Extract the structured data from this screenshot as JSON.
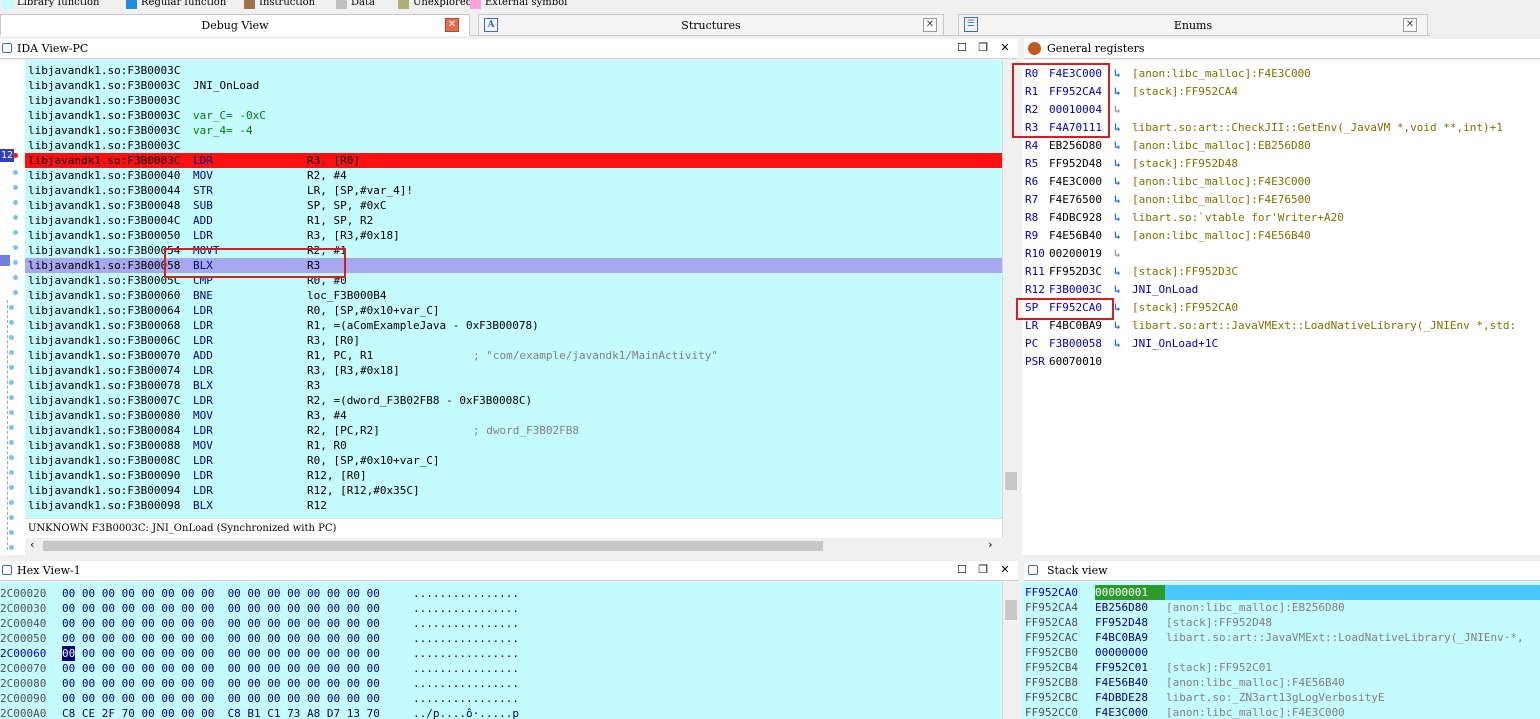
{
  "legend": [
    {
      "label": "Library function",
      "color": "#c4fcff"
    },
    {
      "label": "Regular function",
      "color": "#1e8fd8"
    },
    {
      "label": "Instruction",
      "color": "#a0724c"
    },
    {
      "label": "Data",
      "color": "#c0c0c0"
    },
    {
      "label": "Unexplored",
      "color": "#b0b070"
    },
    {
      "label": "External symbol",
      "color": "#f8a0e0"
    }
  ],
  "tabs": {
    "debug": "Debug View",
    "structures": "Structures",
    "enums": "Enums"
  },
  "ida": {
    "title": "IDA View-PC",
    "status": "UNKNOWN F3B0003C: JNI_OnLoad (Synchronized with PC)",
    "pc_badge": "12",
    "lines": [
      {
        "a": "libjavandk1.so:F3B0003C",
        "m": "",
        "o": "",
        "c": ""
      },
      {
        "a": "libjavandk1.so:F3B0003C",
        "m": "JNI_OnLoad",
        "o": "",
        "c": ""
      },
      {
        "a": "libjavandk1.so:F3B0003C",
        "m": "",
        "o": "",
        "c": ""
      },
      {
        "a": "libjavandk1.so:F3B0003C",
        "m": "var_C= -0xC",
        "o": "",
        "c": ""
      },
      {
        "a": "libjavandk1.so:F3B0003C",
        "m": "var_4= -4",
        "o": "",
        "c": ""
      },
      {
        "a": "libjavandk1.so:F3B0003C",
        "m": "",
        "o": "",
        "c": ""
      },
      {
        "a": "libjavandk1.so:F3B0003C",
        "m": "LDR",
        "o": "R3, [R0]",
        "c": ""
      },
      {
        "a": "libjavandk1.so:F3B00040",
        "m": "MOV",
        "o": "R2, #4",
        "c": ""
      },
      {
        "a": "libjavandk1.so:F3B00044",
        "m": "STR",
        "o": "LR, [SP,#var_4]!",
        "c": ""
      },
      {
        "a": "libjavandk1.so:F3B00048",
        "m": "SUB",
        "o": "SP, SP, #0xC",
        "c": ""
      },
      {
        "a": "libjavandk1.so:F3B0004C",
        "m": "ADD",
        "o": "R1, SP, R2",
        "c": ""
      },
      {
        "a": "libjavandk1.so:F3B00050",
        "m": "LDR",
        "o": "R3, [R3,#0x18]",
        "c": ""
      },
      {
        "a": "libjavandk1.so:F3B00054",
        "m": "MOVT",
        "o": "R2, #1",
        "c": ""
      },
      {
        "a": "libjavandk1.so:F3B00058",
        "m": "BLX",
        "o": "R3",
        "c": ""
      },
      {
        "a": "libjavandk1.so:F3B0005C",
        "m": "CMP",
        "o": "R0, #0",
        "c": ""
      },
      {
        "a": "libjavandk1.so:F3B00060",
        "m": "BNE",
        "o": "loc_F3B000B4",
        "c": ""
      },
      {
        "a": "libjavandk1.so:F3B00064",
        "m": "LDR",
        "o": "R0, [SP,#0x10+var_C]",
        "c": ""
      },
      {
        "a": "libjavandk1.so:F3B00068",
        "m": "LDR",
        "o": "R1, =(aComExampleJava - 0xF3B00078)",
        "c": ""
      },
      {
        "a": "libjavandk1.so:F3B0006C",
        "m": "LDR",
        "o": "R3, [R0]",
        "c": ""
      },
      {
        "a": "libjavandk1.so:F3B00070",
        "m": "ADD",
        "o": "R1, PC, R1",
        "c": "; \"com/example/javandk1/MainActivity\""
      },
      {
        "a": "libjavandk1.so:F3B00074",
        "m": "LDR",
        "o": "R3, [R3,#0x18]",
        "c": ""
      },
      {
        "a": "libjavandk1.so:F3B00078",
        "m": "BLX",
        "o": "R3",
        "c": ""
      },
      {
        "a": "libjavandk1.so:F3B0007C",
        "m": "LDR",
        "o": "R2, =(dword_F3B02FB8 - 0xF3B0008C)",
        "c": ""
      },
      {
        "a": "libjavandk1.so:F3B00080",
        "m": "MOV",
        "o": "R3, #4",
        "c": ""
      },
      {
        "a": "libjavandk1.so:F3B00084",
        "m": "LDR",
        "o": "R2, [PC,R2]",
        "c": "; dword_F3B02FB8"
      },
      {
        "a": "libjavandk1.so:F3B00088",
        "m": "MOV",
        "o": "R1, R0",
        "c": ""
      },
      {
        "a": "libjavandk1.so:F3B0008C",
        "m": "LDR",
        "o": "R0, [SP,#0x10+var_C]",
        "c": ""
      },
      {
        "a": "libjavandk1.so:F3B00090",
        "m": "LDR",
        "o": "R12, [R0]",
        "c": ""
      },
      {
        "a": "libjavandk1.so:F3B00094",
        "m": "LDR",
        "o": "R12, [R12,#0x35C]",
        "c": ""
      },
      {
        "a": "libjavandk1.so:F3B00098",
        "m": "BLX",
        "o": "R12",
        "c": ""
      }
    ]
  },
  "registers": {
    "title": "General registers",
    "rows": [
      {
        "n": "R0",
        "v": "F4E3C000",
        "d": "[anon:libc_malloc]:F4E3C000",
        "k": "olv"
      },
      {
        "n": "R1",
        "v": "FF952CA4",
        "d": "[stack]:FF952CA4",
        "k": "olv"
      },
      {
        "n": "R2",
        "v": "00010004",
        "d": "",
        "k": ""
      },
      {
        "n": "R3",
        "v": "F4A70111",
        "d": "libart.so:art::CheckJII::GetEnv(_JavaVM *,void **,int)+1",
        "k": "olv"
      },
      {
        "n": "R4",
        "v": "EB256D80",
        "d": "[anon:libc_malloc]:EB256D80",
        "k": "olv"
      },
      {
        "n": "R5",
        "v": "FF952D48",
        "d": "[stack]:FF952D48",
        "k": "olv"
      },
      {
        "n": "R6",
        "v": "F4E3C000",
        "d": "[anon:libc_malloc]:F4E3C000",
        "k": "olv"
      },
      {
        "n": "R7",
        "v": "F4E76500",
        "d": "[anon:libc_malloc]:F4E76500",
        "k": "olv"
      },
      {
        "n": "R8",
        "v": "F4DBC928",
        "d": "libart.so:`vtable for'Writer+A20",
        "k": "olv"
      },
      {
        "n": "R9",
        "v": "F4E56B40",
        "d": "[anon:libc_malloc]:F4E56B40",
        "k": "olv"
      },
      {
        "n": "R10",
        "v": "00200019",
        "d": "",
        "k": ""
      },
      {
        "n": "R11",
        "v": "FF952D3C",
        "d": "[stack]:FF952D3C",
        "k": "olv"
      },
      {
        "n": "R12",
        "v": "F3B0003C",
        "d": "JNI_OnLoad",
        "k": "blu"
      },
      {
        "n": "SP",
        "v": "FF952CA0",
        "d": "[stack]:FF952CA0",
        "k": "olv"
      },
      {
        "n": "LR",
        "v": "F4BC0BA9",
        "d": "libart.so:art::JavaVMExt::LoadNativeLibrary(_JNIEnv *,std:",
        "k": "olv"
      },
      {
        "n": "PC",
        "v": "F3B00058",
        "d": "JNI_OnLoad+1C",
        "k": "blu"
      },
      {
        "n": "PSR",
        "v": "60070010",
        "d": "",
        "k": "none"
      }
    ]
  },
  "hex": {
    "title": "Hex View-1",
    "rows": [
      {
        "a": "2C00020",
        "b": "00 00 00 00 00 00 00 00  00 00 00 00 00 00 00 00",
        "s": "................"
      },
      {
        "a": "2C00030",
        "b": "00 00 00 00 00 00 00 00  00 00 00 00 00 00 00 00",
        "s": "................"
      },
      {
        "a": "2C00040",
        "b": "00 00 00 00 00 00 00 00  00 00 00 00 00 00 00 00",
        "s": "................"
      },
      {
        "a": "2C00050",
        "b": "00 00 00 00 00 00 00 00  00 00 00 00 00 00 00 00",
        "s": "................"
      },
      {
        "a": "2C00060",
        "b": "00 00 00 00 00 00 00 00  00 00 00 00 00 00 00 00",
        "s": "................"
      },
      {
        "a": "2C00070",
        "b": "00 00 00 00 00 00 00 00  00 00 00 00 00 00 00 00",
        "s": "................"
      },
      {
        "a": "2C00080",
        "b": "00 00 00 00 00 00 00 00  00 00 00 00 00 00 00 00",
        "s": "................"
      },
      {
        "a": "2C00090",
        "b": "00 00 00 00 00 00 00 00  00 00 00 00 00 00 00 00",
        "s": "................"
      },
      {
        "a": "2C000A0",
        "b": "C8 CE 2F 70 00 00 00 00  C8 B1 C1 73 A8 D7 13 70",
        "s": "../p....ô·.....p"
      }
    ]
  },
  "stack": {
    "title": "Stack view",
    "rows": [
      {
        "a": "FF952CA0",
        "v": "00000001",
        "d": ""
      },
      {
        "a": "FF952CA4",
        "v": "EB256D80",
        "d": "[anon:libc_malloc]:EB256D80"
      },
      {
        "a": "FF952CA8",
        "v": "FF952D48",
        "d": "[stack]:FF952D48"
      },
      {
        "a": "FF952CAC",
        "v": "F4BC0BA9",
        "d": "libart.so:art::JavaVMExt::LoadNativeLibrary(_JNIEnv·*,"
      },
      {
        "a": "FF952CB0",
        "v": "00000000",
        "d": ""
      },
      {
        "a": "FF952CB4",
        "v": "FF952C01",
        "d": "[stack]:FF952C01"
      },
      {
        "a": "FF952CB8",
        "v": "F4E56B40",
        "d": "[anon:libc_malloc]:F4E56B40"
      },
      {
        "a": "FF952CBC",
        "v": "F4DBDE28",
        "d": "libart.so:_ZN3art13gLogVerbosityE"
      },
      {
        "a": "FF952CC0",
        "v": "F4E3C000",
        "d": "[anon:libc_malloc]:F4E3C000"
      }
    ]
  }
}
